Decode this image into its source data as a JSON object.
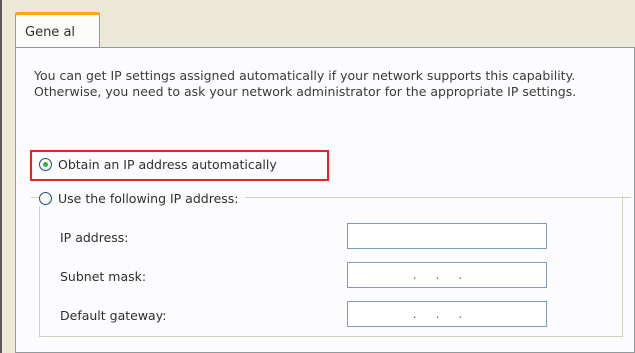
{
  "tabs": {
    "general_label": "Gene al"
  },
  "description": "You can get IP settings assigned automatically if your network supports this capability. Otherwise, you need to ask your network administrator for the appropriate IP settings.",
  "options": {
    "auto_label": "Obtain an IP address automatically",
    "manual_label": "Use the following IP address:"
  },
  "fields": {
    "ip_label": "IP address:",
    "subnet_label": "Subnet mask:",
    "gateway_label": "Default gateway:",
    "ip_value": "",
    "subnet_value": "...",
    "gateway_value": "..."
  },
  "colors": {
    "highlight": "#e0252b",
    "accent_tab": "#f5a623"
  }
}
